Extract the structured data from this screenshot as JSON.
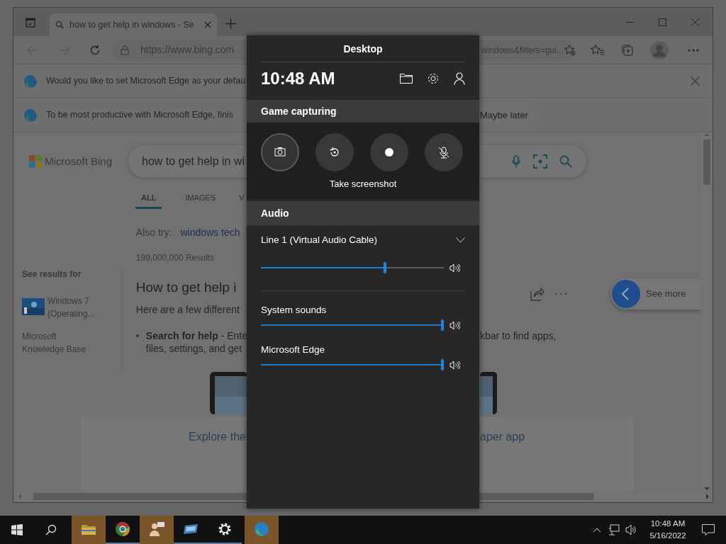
{
  "browser": {
    "tab_title": "how to get help in windows - Se",
    "address_left": "https://www.bing.com",
    "address_right": "windows&filters=gui...",
    "infobars": [
      {
        "text": "Would you like to set Microsoft Edge as your defau"
      },
      {
        "text": "To be most productive with Microsoft Edge, finis",
        "action": "Maybe later"
      }
    ],
    "page": {
      "logo": "Microsoft Bing",
      "query": "how to get help in wi",
      "tabs": [
        {
          "label": "ALL",
          "selected": true
        },
        {
          "label": "IMAGES",
          "selected": false
        },
        {
          "label": "V",
          "selected": false
        }
      ],
      "also_try_label": "Also try:",
      "also_try_link": "windows tech",
      "results_count": "199,000,000 Results",
      "see_results_for": "See results for",
      "entities": [
        {
          "lines": [
            "Windows 7",
            "(Operating..."
          ],
          "thumbnail": true
        },
        {
          "lines": [
            "Microsoft",
            "Knowledge Base"
          ],
          "thumbnail": false
        }
      ],
      "result_title": "How to get help i",
      "result_intro": "Here are a few different",
      "bullet_lines": [
        "**Search for help** - Ente",
        "files, settings, and get"
      ],
      "bullet_right": "kbar to find apps,",
      "see_more": "See more",
      "explore_left": "Explore the",
      "explore_right": "aper app"
    }
  },
  "game_bar": {
    "title": "Desktop",
    "time": "10:48 AM",
    "capture_header": "Game capturing",
    "capture_buttons": [
      {
        "kind": "screenshot",
        "selected": true
      },
      {
        "kind": "replay",
        "selected": false
      },
      {
        "kind": "record",
        "selected": false
      },
      {
        "kind": "mic-off",
        "selected": false
      }
    ],
    "capture_caption": "Take screenshot",
    "audio_header": "Audio",
    "mixers": [
      {
        "name": "Line 1 (Virtual Audio Cable)",
        "dropdown": true,
        "level": 0.68
      },
      {
        "name": "System sounds",
        "dropdown": false,
        "level": 1
      },
      {
        "name": "Microsoft Edge",
        "dropdown": false,
        "level": 1
      }
    ]
  },
  "taskbar": {
    "apps": [
      {
        "kind": "folder",
        "flashing": true,
        "running": false
      },
      {
        "kind": "chrome",
        "flashing": false,
        "running": true
      },
      {
        "kind": "people",
        "flashing": true,
        "running": false
      },
      {
        "kind": "window",
        "flashing": false,
        "running": true
      },
      {
        "kind": "settings",
        "flashing": false,
        "running": true
      },
      {
        "kind": "edge",
        "flashing": true,
        "running": false
      }
    ],
    "time": "10:48 AM",
    "date": "5/16/2022"
  }
}
